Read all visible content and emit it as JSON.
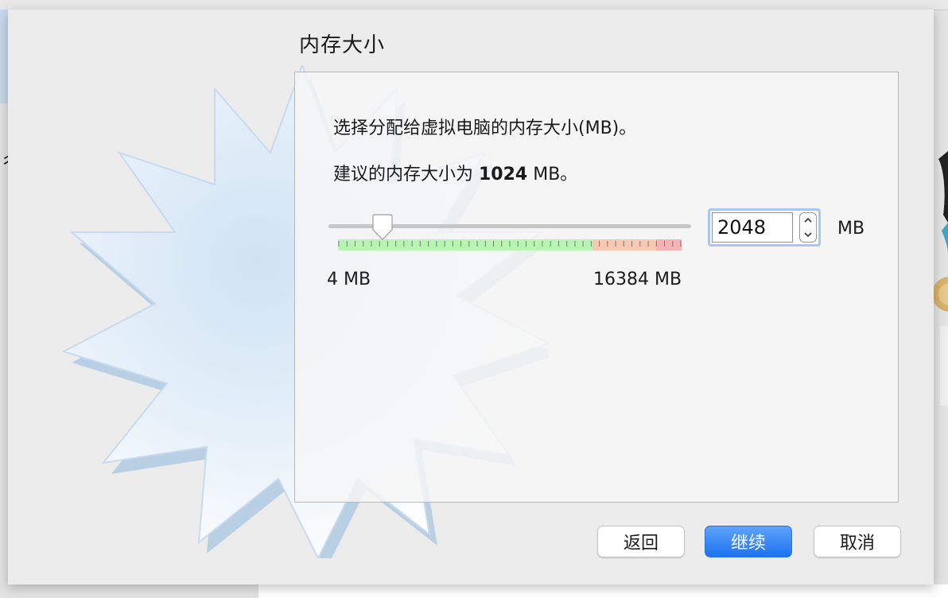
{
  "page": {
    "title": "内存大小"
  },
  "panel": {
    "description": "选择分配给虚拟电脑的内存大小(MB)。",
    "recommend_prefix": "建议的内存大小为 ",
    "recommend_value": "1024",
    "recommend_suffix": " MB。"
  },
  "slider": {
    "min_label": "4 MB",
    "max_label": "16384 MB",
    "value_fraction": 0.125,
    "zones": [
      "green",
      "orange",
      "red"
    ],
    "colors": {
      "green": "#b8f5b3",
      "orange": "#f8c9b2",
      "red": "#f6b3b3",
      "track": "#c6c6c6"
    }
  },
  "memory_input": {
    "value": "2048",
    "unit": "MB"
  },
  "buttons": {
    "back": "返回",
    "continue": "继续",
    "cancel": "取消"
  },
  "colors": {
    "accent": "#1d73f2",
    "focus_ring": "#a9c7ee"
  },
  "icons": {
    "spin_up": "chevron-up-icon",
    "spin_down": "chevron-down-icon",
    "background_art": "starburst-icon"
  }
}
